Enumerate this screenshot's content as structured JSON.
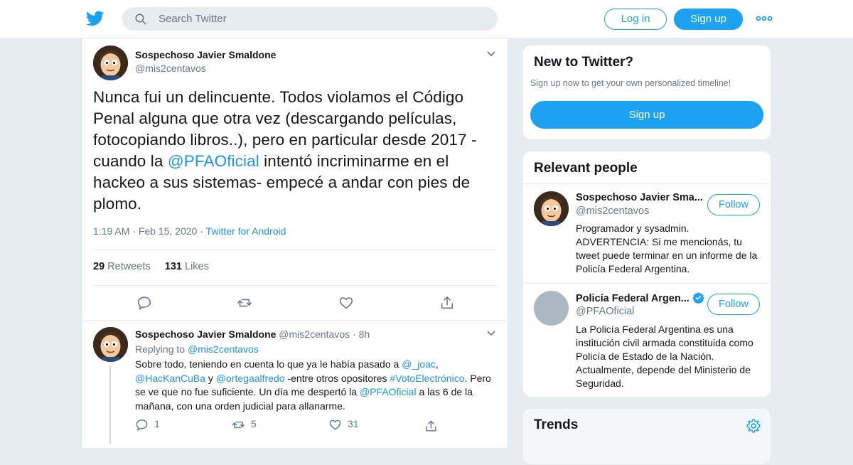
{
  "topbar": {
    "search_placeholder": "Search Twitter",
    "login_label": "Log in",
    "signup_label": "Sign up",
    "brand_color": "#1da1f2"
  },
  "tweet": {
    "author_name": "Sospechoso Javier Smaldone",
    "author_handle": "@mis2centavos",
    "text_before": "Nunca fui un delincuente. Todos violamos el Código Penal alguna que otra vez (descargando películas, fotocopiando libros..), pero en particular desde 2017 - cuando la ",
    "mention": "@PFAOficial",
    "text_after": " intentó incriminarme en el hackeo a sus sistemas- empecé a andar con pies de plomo.",
    "time": "1:19 AM",
    "sep": "·",
    "date": "Feb 15, 2020",
    "source": "Twitter for Android",
    "retweets_count": "29",
    "retweets_label": "Retweets",
    "likes_count": "131",
    "likes_label": "Likes"
  },
  "reply": {
    "author_name": "Sospechoso Javier Smaldone",
    "author_handle": "@mis2centavos",
    "dot": "·",
    "age": "8h",
    "replying_label": "Replying to",
    "replying_handle": "@mis2centavos",
    "p1": "Sobre todo, teniendo en cuenta lo que ya le había pasado a ",
    "m1": "@_joac",
    "p2": ", ",
    "m2": "@HacKanCuBa",
    "p3": " y ",
    "m3": "@ortegaalfredo",
    "p4": " -entre otros opositores  ",
    "m4": "#VotoElectrónico",
    "p5": ". Pero se ve que no fue suficiente. Un día me despertó la ",
    "m5": "@PFAOficial",
    "p6": " a las 6 de la mañana, con una orden judicial para allanarme.",
    "replies": "1",
    "retweets": "5",
    "likes": "31"
  },
  "new_to_twitter": {
    "title": "New to Twitter?",
    "subtitle": "Sign up now to get your own personalized timeline!",
    "button": "Sign up"
  },
  "relevant_people": {
    "title": "Relevant people",
    "people": [
      {
        "name": "Sospechoso Javier Sma...",
        "handle": "@mis2centavos",
        "bio": "Programador y sysadmin. ADVERTENCIA: Si me mencionás, tu tweet puede terminar en un informe de la Policía Federal Argentina.",
        "follow": "Follow"
      },
      {
        "name": "Policía Federal Argen...",
        "handle": "@PFAOficial",
        "bio": "La Policía Federal Argentina es una institución civil armada constituida como Policía de Estado de la Nación. Actualmente, depende del Ministerio de Seguridad.",
        "follow": "Follow",
        "verified_icon": "verified-badge-icon"
      }
    ]
  },
  "trends": {
    "title": "Trends"
  }
}
